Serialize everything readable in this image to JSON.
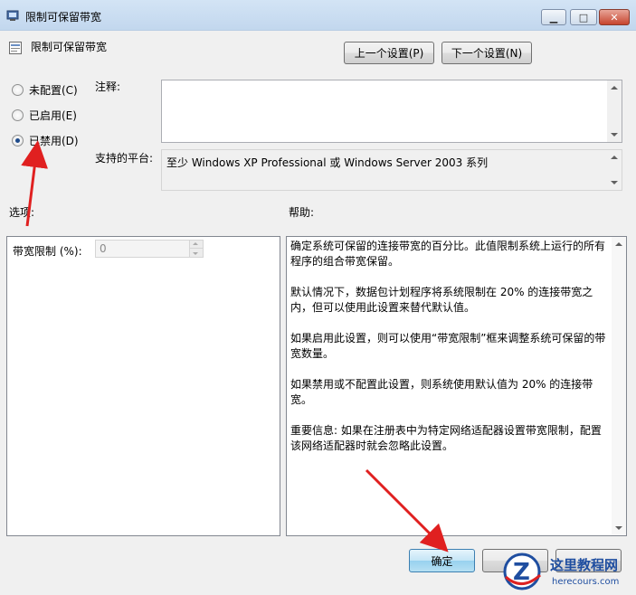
{
  "window": {
    "title": "限制可保留带宽",
    "controls": [
      "minimize",
      "maximize",
      "close"
    ]
  },
  "header": {
    "title": "限制可保留带宽",
    "prev_button": "上一个设置(P)",
    "next_button": "下一个设置(N)"
  },
  "state": {
    "options": [
      {
        "label": "未配置(C)",
        "checked": false
      },
      {
        "label": "已启用(E)",
        "checked": false
      },
      {
        "label": "已禁用(D)",
        "checked": true
      }
    ]
  },
  "comment": {
    "label": "注释:",
    "value": ""
  },
  "platform": {
    "label": "支持的平台:",
    "value": "至少 Windows XP Professional 或 Windows Server 2003 系列"
  },
  "options_section": {
    "label": "选项:",
    "bandwidth_label": "带宽限制 (%):",
    "bandwidth_value": "0"
  },
  "help_section": {
    "label": "帮助:",
    "paragraphs": [
      "确定系统可保留的连接带宽的百分比。此值限制系统上运行的所有程序的组合带宽保留。",
      "默认情况下，数据包计划程序将系统限制在 20% 的连接带宽之内，但可以使用此设置来替代默认值。",
      "如果启用此设置，则可以使用“带宽限制”框来调整系统可保留的带宽数量。",
      "如果禁用或不配置此设置，则系统使用默认值为 20% 的连接带宽。",
      "重要信息: 如果在注册表中为特定网络适配器设置带宽限制，配置该网络适配器时就会忽略此设置。"
    ]
  },
  "footer": {
    "ok_button": "确定"
  },
  "watermark": {
    "site_name": "这里教程网",
    "site_url": "herecours.com"
  },
  "colors": {
    "annotation_arrow": "#e02020",
    "titlebar": "#c8dbf0"
  }
}
